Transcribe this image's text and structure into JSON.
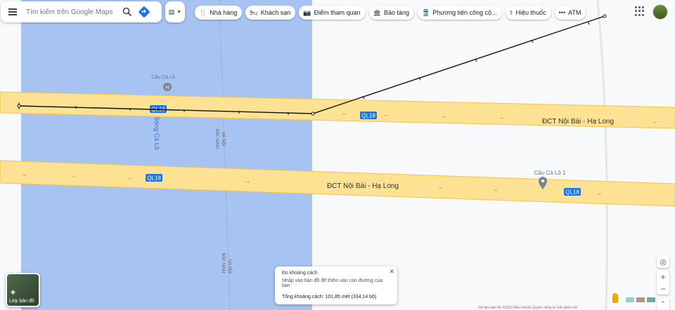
{
  "search": {
    "placeholder": "Tìm kiếm trên Google Maps"
  },
  "hotel_filter": {
    "icon": "bed-icon"
  },
  "chips": [
    {
      "icon": "restaurant-icon",
      "label": "Nhà hàng"
    },
    {
      "icon": "hotel-icon",
      "label": "Khách sạn"
    },
    {
      "icon": "camera-icon",
      "label": "Điểm tham quan"
    },
    {
      "icon": "museum-icon",
      "label": "Bảo tàng"
    },
    {
      "icon": "transit-icon",
      "label": "Phương tiện công cộ..."
    },
    {
      "icon": "pharmacy-icon",
      "label": "Hiệu thuốc"
    },
    {
      "icon": "atm-icon",
      "label": "ATM"
    }
  ],
  "map": {
    "colors": {
      "water": "#a7c3f2",
      "road": "#fde293",
      "road_edge": "#f5c34a",
      "land": "#f8f9fa",
      "shield": "#1a73e8"
    },
    "road_shields": [
      "QL18",
      "QL18",
      "QL18",
      "QL18"
    ],
    "road_names": [
      "ĐCT Nội Bài - Hạ Long",
      "ĐCT Nội Bài - Hạ Long"
    ],
    "places": {
      "poi_left": "Cầu Cà Lồ",
      "poi_right": "Cầu Cà Lồ 1",
      "river": "Sông Cà Lồ"
    },
    "boundary_labels": [
      "BẮC NINH",
      "HÀ NỘI",
      "BẮC NINH",
      "HÀ NỘI"
    ]
  },
  "layers": {
    "label": "Lớp bản đồ"
  },
  "measure": {
    "title": "Đo khoảng cách",
    "hint": "Nhấp vào bản đồ để thêm vào con đường của bạn",
    "total": "Tổng khoảng cách: 101,85 mét (334,14 bộ)"
  },
  "footer": "Dữ liệu bản đồ ©2023   Điều khoản   Quyền riêng tư   Gửi phản hồi"
}
